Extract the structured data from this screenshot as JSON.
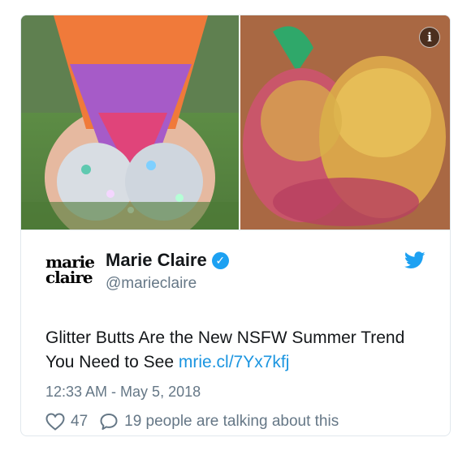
{
  "tweet": {
    "author_name": "Marie Claire",
    "handle": "@marieclaire",
    "logo_line1": "marie",
    "logo_line2": "claire",
    "text": "Glitter Butts Are the New NSFW Summer Trend You Need to See",
    "link": "mrie.cl/7Yx7kfj",
    "timestamp": "12:33 AM - May 5, 2018",
    "likes": "47",
    "talking": "19 people are talking about this",
    "info_glyph": "i"
  },
  "icons": {
    "verified": "verified-badge-icon",
    "bird": "twitter-bird-icon",
    "heart": "heart-icon",
    "reply": "speech-bubble-icon",
    "info": "info-icon"
  },
  "colors": {
    "brand": "#1da1f2",
    "link": "#1b95e0",
    "muted": "#657786",
    "text": "#14171a"
  }
}
